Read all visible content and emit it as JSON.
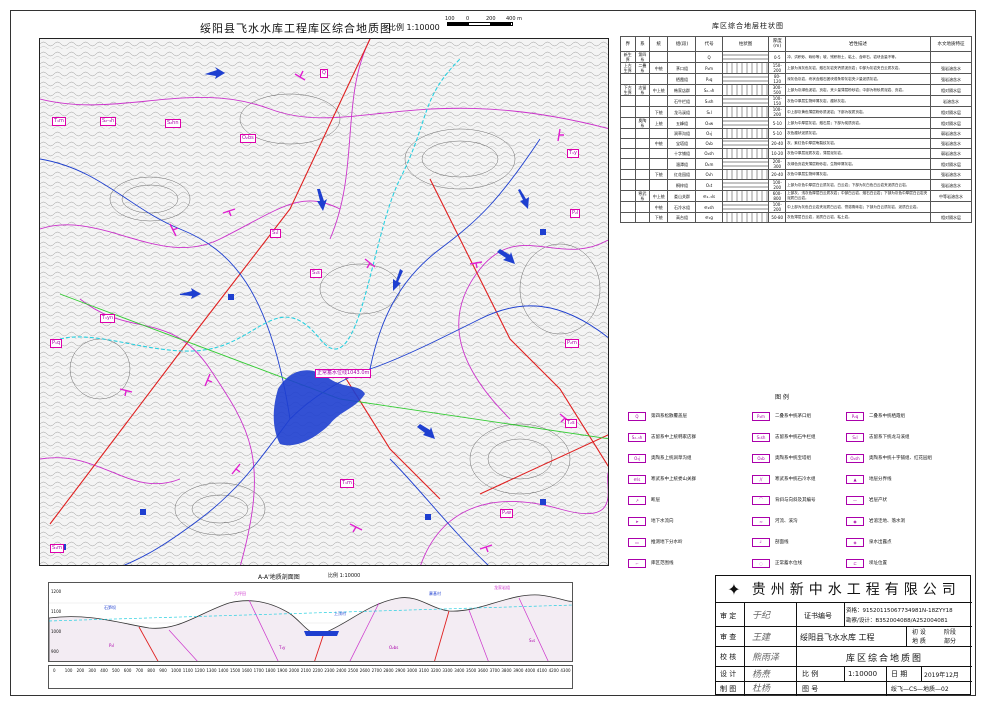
{
  "map": {
    "title": "绥阳县飞水水库工程库区综合地质图",
    "scale_label": "比例 1:10000",
    "scalebar_ticks": [
      "100",
      "0",
      "200",
      "400 m"
    ],
    "water_level_label": "正常蓄水位线1043.0m",
    "unit_labels": [
      "T₁m",
      "T₁y",
      "P₂l",
      "P₂m",
      "S₂-₃h",
      "S₂hn",
      "O₂bs",
      "S₁s",
      "S₁l",
      "Q",
      "T₂s",
      "P₁q",
      "T₁yn",
      "S₁m",
      "T₁m",
      "P₂w"
    ]
  },
  "section": {
    "title": "A-A'地质剖面图",
    "scale": "比例 1:10000",
    "y_ticks": [
      "1200",
      "1100",
      "1000",
      "900"
    ],
    "x_ticks": [
      "0",
      "100",
      "200",
      "300",
      "400",
      "500",
      "600",
      "700",
      "800",
      "900",
      "1000",
      "1100",
      "1200",
      "1300",
      "1400",
      "1500",
      "1600",
      "1700",
      "1800",
      "1900",
      "2000",
      "2100",
      "2200",
      "2300",
      "2400",
      "2500",
      "2600",
      "2700",
      "2800",
      "2900",
      "3000",
      "3100",
      "3200",
      "3300",
      "3400",
      "3500",
      "3600",
      "3700",
      "3800",
      "3900",
      "4000",
      "4100",
      "4200",
      "4300"
    ],
    "labels": [
      "石笋坝",
      "寨基村",
      "上顶村",
      "龙家岩组",
      "大坪田",
      "S₁s",
      "O₂bs",
      "T₁y",
      "P₂l"
    ]
  },
  "strat_table": {
    "title": "库区综合地层柱状图",
    "headers": [
      "界",
      "系",
      "统",
      "组(段)",
      "代号",
      "柱状图",
      "厚度(m)",
      "岩性描述",
      "水文地质特征"
    ],
    "rows": [
      {
        "era": "新生界",
        "system": "第四系",
        "series": "",
        "group": "",
        "code": "Q",
        "thick": "0-5",
        "desc": "冲、洪积砂、砾砂等；坡、残积粉土、粘土、含碎石，岩块含量不等。",
        "hydro": ""
      },
      {
        "era": "上古生界",
        "system": "二叠系",
        "series": "中统",
        "group": "茅口组",
        "code": "P₂m",
        "thick": "150-200",
        "desc": "上部为深灰色灰岩，燧石灰岩夹钙质泥页岩；中部为灰岩夹白云质灰岩。",
        "hydro": "强岩溶含水"
      },
      {
        "era": "",
        "system": "",
        "series": "",
        "group": "栖霞组",
        "code": "P₂q",
        "thick": "80-120",
        "desc": "深灰色灰岩，块状含燧石团块或条带灰岩夹少量泥质灰岩。",
        "hydro": "强岩溶含水"
      },
      {
        "era": "下古生界",
        "system": "志留系",
        "series": "中上统",
        "group": "韩家店群",
        "code": "S₂₋₃h",
        "thick": "300-500",
        "desc": "上部为灰绿色泥岩、页岩，夹少量薄层粉砂岩；中部为粉砂质泥岩、页岩。",
        "hydro": "相对隔水层"
      },
      {
        "era": "",
        "system": "",
        "series": "",
        "group": "石牛栏组",
        "code": "S₁sh",
        "thick": "100-150",
        "desc": "灰色中厚层生物碎屑灰岩，瘤状灰岩。",
        "hydro": "岩溶含水"
      },
      {
        "era": "",
        "system": "",
        "series": "下统",
        "group": "龙马溪组",
        "code": "S₁l",
        "thick": "100-200",
        "desc": "中上部灰黄色薄层粉砂质泥岩；下部为炭质页岩。",
        "hydro": "相对隔水层"
      },
      {
        "era": "",
        "system": "奥陶系",
        "series": "上统",
        "group": "五峰组",
        "code": "O₃w",
        "thick": "5-10",
        "desc": "上部为中厚层灰岩，燧石层；下部为炭质页岩。",
        "hydro": "相对隔水层"
      },
      {
        "era": "",
        "system": "",
        "series": "",
        "group": "涧草沟组",
        "code": "O₃j",
        "thick": "5-10",
        "desc": "灰色瘤状泥质灰岩。",
        "hydro": "弱岩溶含水"
      },
      {
        "era": "",
        "system": "",
        "series": "中统",
        "group": "宝塔组",
        "code": "O₂b",
        "thick": "20-40",
        "desc": "灰、紫红色中厚层龟裂纹灰岩。",
        "hydro": "强岩溶含水"
      },
      {
        "era": "",
        "system": "",
        "series": "",
        "group": "十字铺组",
        "code": "O₂sh",
        "thick": "10-20",
        "desc": "灰色中厚层泥质灰岩，薄层泥灰岩。",
        "hydro": "弱岩溶含水"
      },
      {
        "era": "",
        "system": "",
        "series": "",
        "group": "湄潭组",
        "code": "O₁m",
        "thick": "200-300",
        "desc": "灰绿色页岩夹薄层粉砂岩，生物碎屑灰岩。",
        "hydro": "相对隔水层"
      },
      {
        "era": "",
        "system": "",
        "series": "下统",
        "group": "红花园组",
        "code": "O₁h",
        "thick": "20-40",
        "desc": "灰色中厚层生物碎屑灰岩。",
        "hydro": "强岩溶含水"
      },
      {
        "era": "",
        "system": "",
        "series": "",
        "group": "桐梓组",
        "code": "O₁t",
        "thick": "100-200",
        "desc": "上部为灰色中厚层白云质灰岩，白云岩；下部为灰白色白云岩夹泥质白云岩。",
        "hydro": "强岩溶含水"
      },
      {
        "era": "",
        "system": "寒武系",
        "series": "中上统",
        "group": "娄山关群",
        "code": "∈₂₋₃ls",
        "thick": "600-800",
        "desc": "上部灰、浅灰色厚层白云质灰岩；中部白云岩、燧石白云岩；下部为灰色中厚层白云岩夹泥质白云岩。",
        "hydro": "中等岩溶含水"
      },
      {
        "era": "",
        "system": "",
        "series": "中统",
        "group": "石冷水组",
        "code": "∈₂sh",
        "thick": "100-200",
        "desc": "中上部为灰色白云岩夹泥质白云岩、膏溶角砾岩；下部为白云质灰岩、泥质白云岩。",
        "hydro": ""
      },
      {
        "era": "",
        "system": "",
        "series": "下统",
        "group": "高台组",
        "code": "∈₁g",
        "thick": "50-80",
        "desc": "灰色薄层白云岩，泥质白云岩，粘土岩。",
        "hydro": "相对隔水层"
      }
    ]
  },
  "legend": {
    "title": "图 例",
    "items": [
      {
        "sym": "Q",
        "label": "第四系松散覆盖层"
      },
      {
        "sym": "P₂m",
        "label": "二叠系中统茅口组"
      },
      {
        "sym": "P₂q",
        "label": "二叠系中统栖霞组"
      },
      {
        "sym": "S₂₋₃h",
        "label": "志留系中上统韩家店群"
      },
      {
        "sym": "S₁sh",
        "label": "志留系中统石牛栏组"
      },
      {
        "sym": "S₁l",
        "label": "志留系下统龙马溪组"
      },
      {
        "sym": "O₃j",
        "label": "奥陶系上统涧草沟组"
      },
      {
        "sym": "O₂b",
        "label": "奥陶系中统宝塔组"
      },
      {
        "sym": "O₂sh",
        "label": "奥陶系中统十字铺组、红花园组"
      },
      {
        "sym": "∈ls",
        "label": "寒武系中上统娄山关群"
      },
      {
        "sym": "//",
        "label": "寒武系中统石冷水组"
      },
      {
        "sym": "▲",
        "label": "地层分界线"
      },
      {
        "sym": "↗",
        "label": "断层"
      },
      {
        "sym": "⌒",
        "label": "背斜与向斜及其编号"
      },
      {
        "sym": "—",
        "label": "岩层产状"
      },
      {
        "sym": "➤",
        "label": "地下水流向"
      },
      {
        "sym": "≈",
        "label": "河流、溪沟"
      },
      {
        "sym": "◉",
        "label": "岩溶洼地、落水洞"
      },
      {
        "sym": "▭",
        "label": "推测地下分水岭"
      },
      {
        "sym": "┘",
        "label": "剖面线"
      },
      {
        "sym": "◈",
        "label": "泉水出露点"
      },
      {
        "sym": "⌐",
        "label": "库区范围线"
      },
      {
        "sym": "◌",
        "label": "正常蓄水位线"
      },
      {
        "sym": "⊏",
        "label": "坝址位置"
      }
    ]
  },
  "titleblock": {
    "company": "贵州新中水工程有限公司",
    "review_label": "审 定",
    "cert_label": "证书编号",
    "cert_no1": "资格：91520115067734981N-18ZYY18",
    "cert_no2": "勘察/设计：B352004088/A252004081",
    "check_label": "审 查",
    "project": "绥阳县飞水水库 工程",
    "stage_label": "初 设",
    "stage_val": "阶段",
    "part_label": "地 质",
    "part_val": "部分",
    "verify_label": "校 核",
    "drawing_name": "库区综合地质图",
    "design_label": "设 计",
    "scale_label": "比 例",
    "scale_val": "1:10000",
    "date_label": "日 期",
    "date_val": "2019年12月",
    "draw_label": "制 图",
    "drawno_label": "图 号",
    "drawno_val": "绥飞—CS—地质—02",
    "sig_review": "于纪",
    "sig_check": "王建",
    "sig_verify": "熊雨泽",
    "sig_design": "杨焘",
    "sig_draw": "杜杨"
  }
}
